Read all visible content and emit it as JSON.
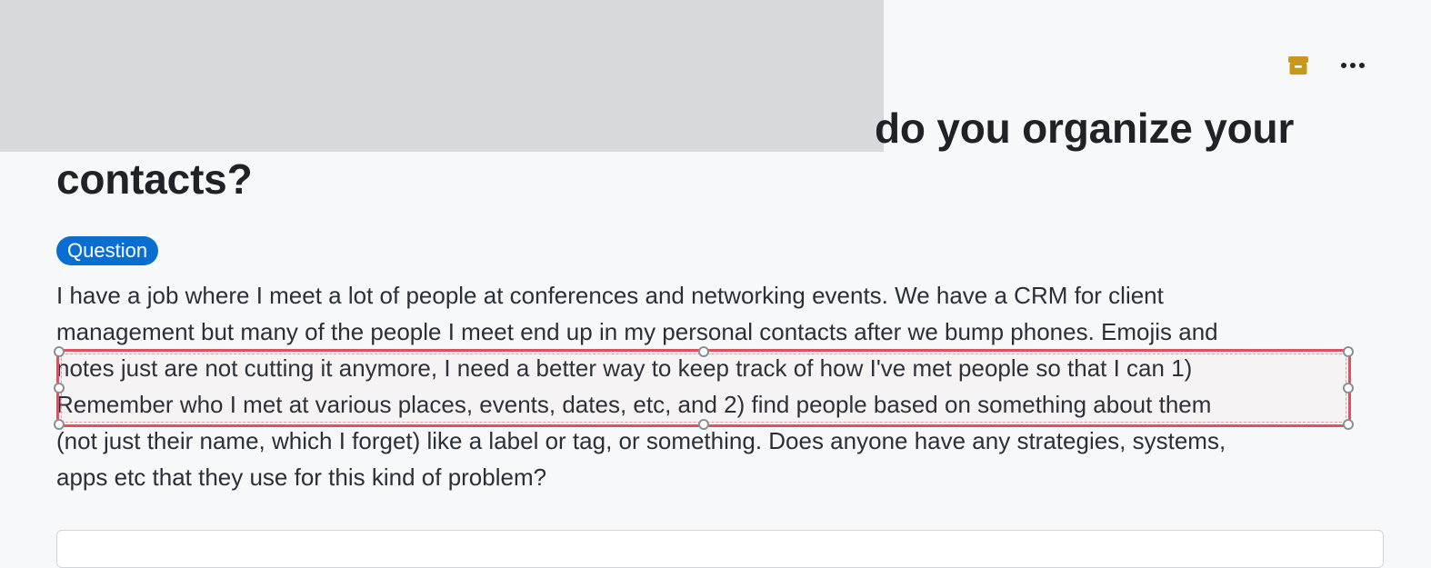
{
  "post": {
    "title_line1": "do you organize your",
    "title_line2": "contacts?",
    "badge": "Question",
    "body_lines": [
      "I have a job where I meet a lot of people at conferences and networking events. We have a CRM for client",
      "management but many of the people I meet end up in my personal contacts after we bump phones. Emojis and",
      "notes just are not cutting it anymore, I need a better way to keep track of how I've met people so that I can 1)",
      "Remember who I met at various places, events, dates, etc, and 2) find people based on something about them",
      "(not just their name, which I forget) like a label or tag, or something. Does anyone have any strategies, systems,",
      "apps etc that they use for this kind of problem?"
    ]
  },
  "toolbar": {
    "archive_icon": "archive-icon",
    "more_icon": "more-horizontal-icon"
  },
  "colors": {
    "badge_bg": "#0a6ed1",
    "archive_icon": "#c9971c",
    "selection": "#e0515f",
    "redaction": "#d7d9dd"
  }
}
